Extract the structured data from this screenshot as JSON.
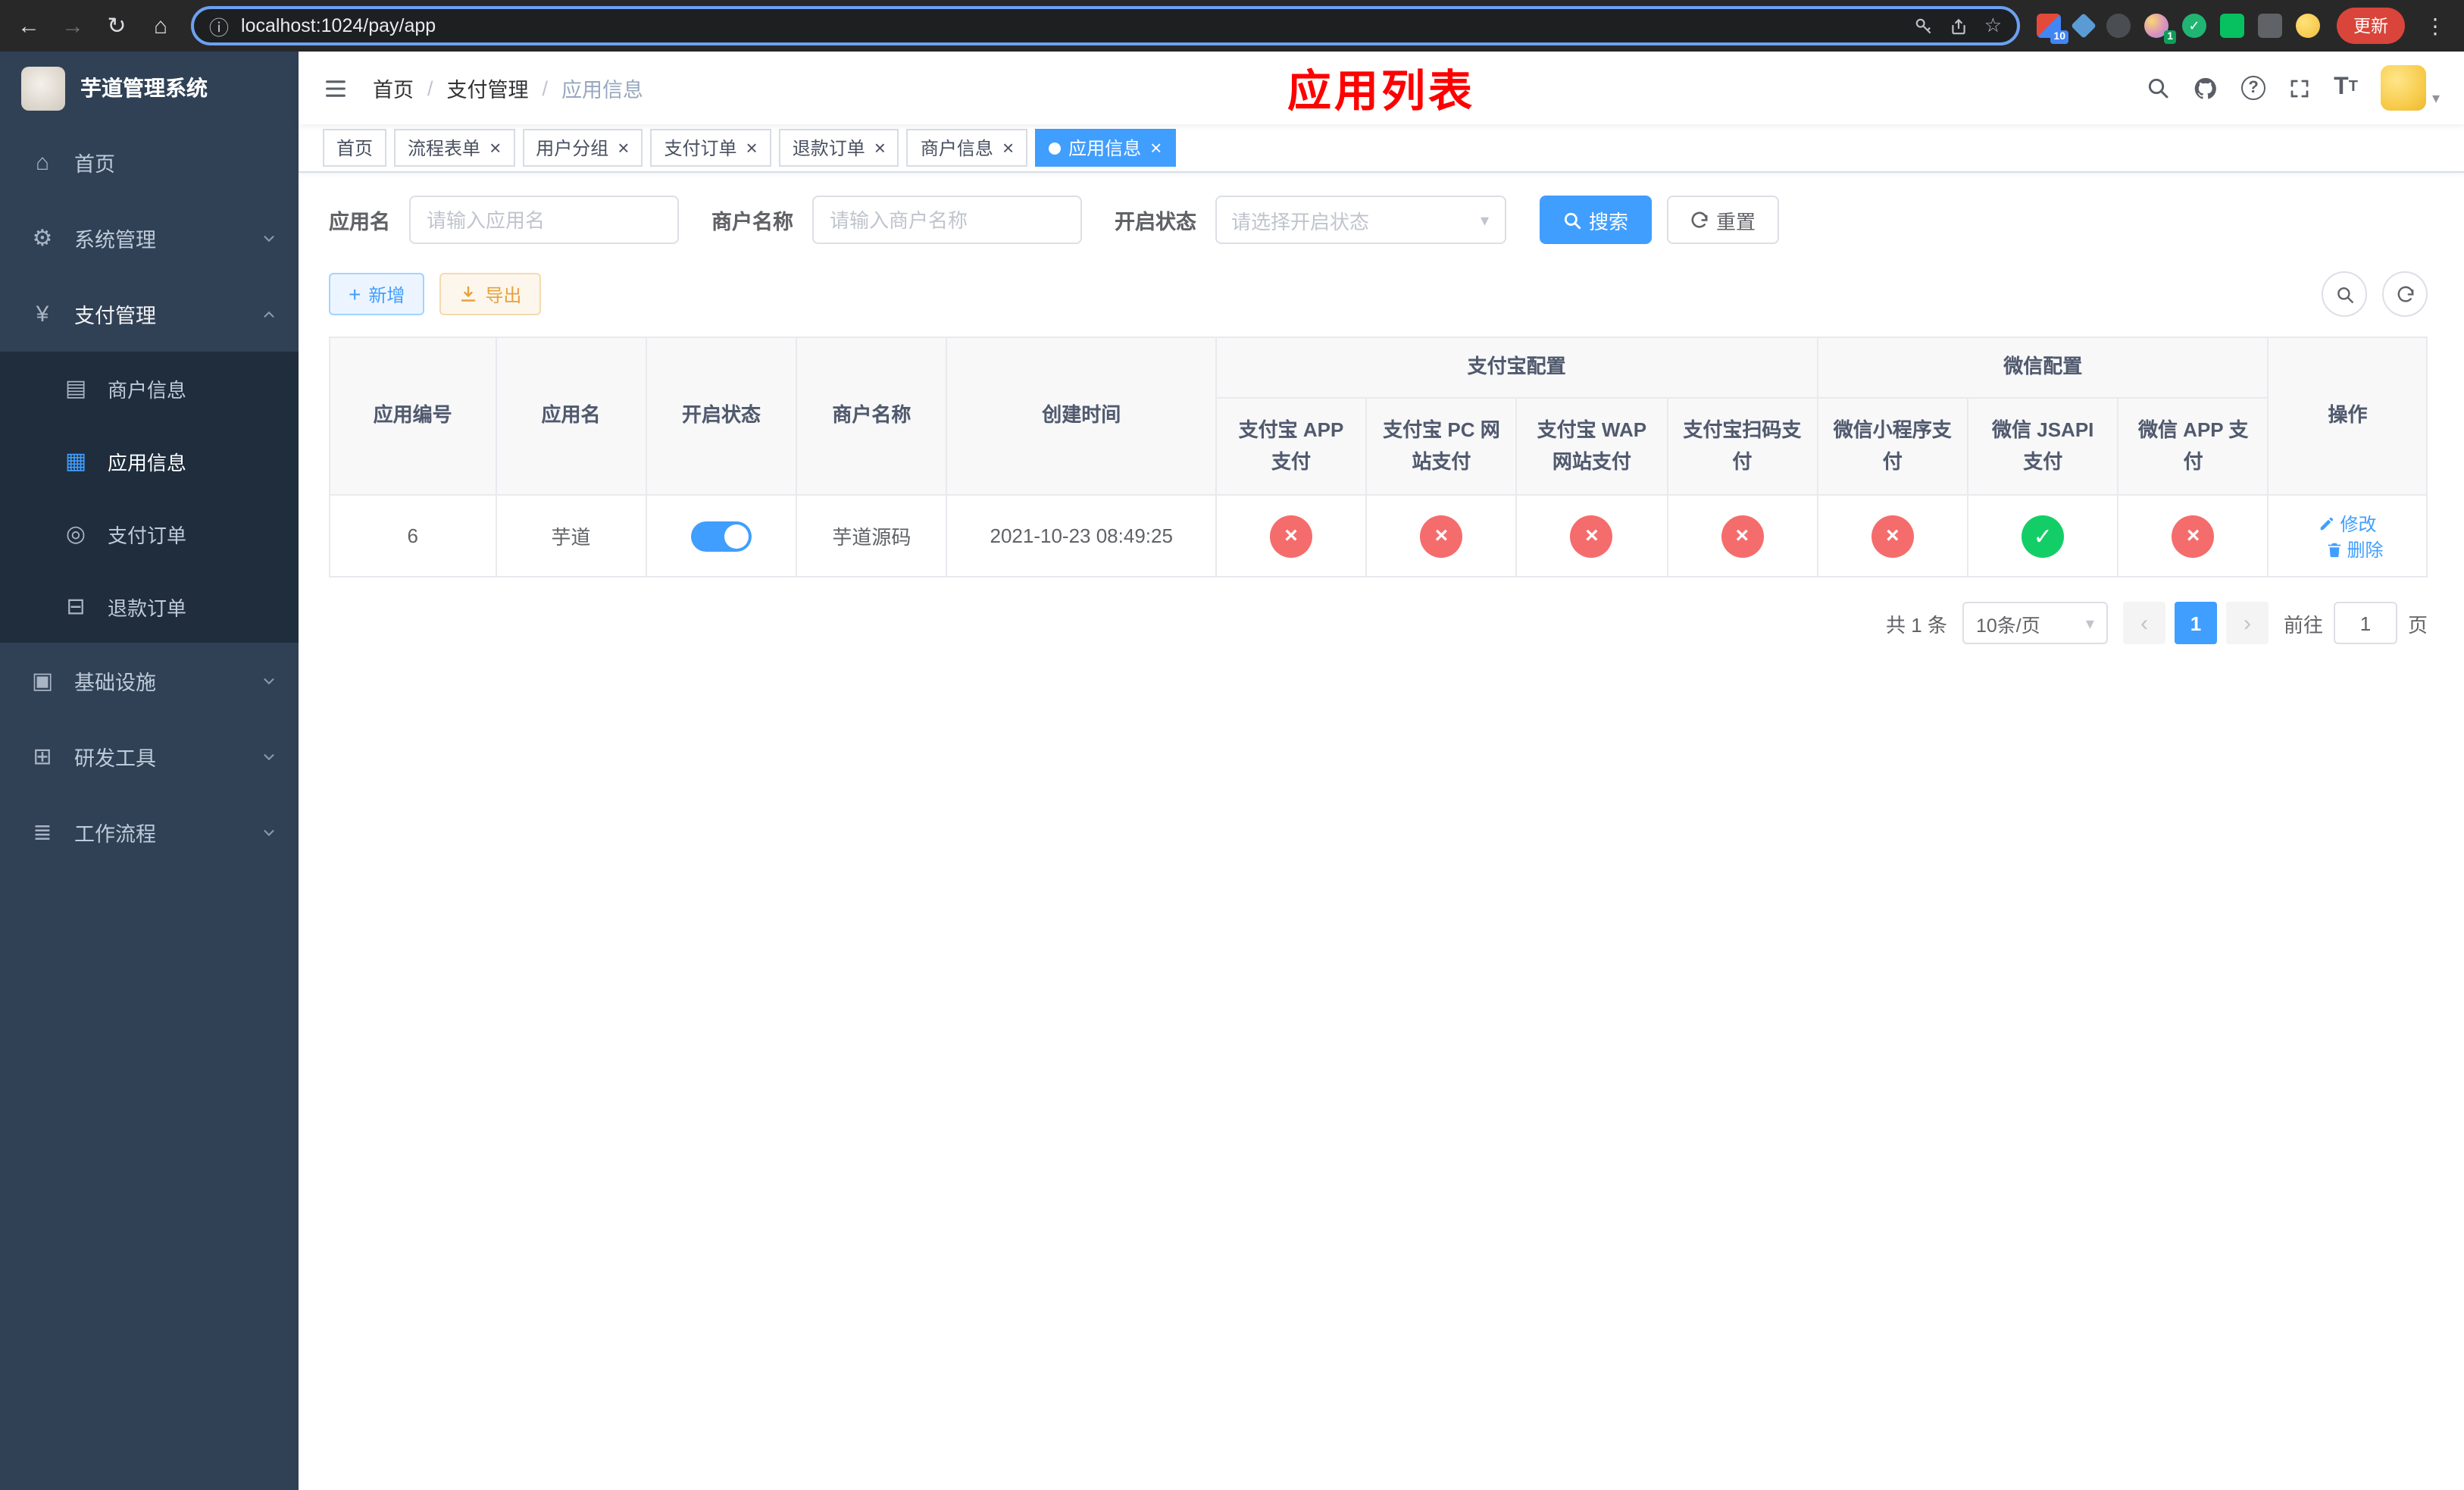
{
  "browser": {
    "url": "localhost:1024/pay/app",
    "update_label": "更新",
    "extension_badge": "10",
    "avatar_badge": "1"
  },
  "sidebar": {
    "logo_title": "芋道管理系统",
    "items": [
      {
        "label": "首页"
      },
      {
        "label": "系统管理"
      },
      {
        "label": "支付管理",
        "children": [
          {
            "label": "商户信息"
          },
          {
            "label": "应用信息"
          },
          {
            "label": "支付订单"
          },
          {
            "label": "退款订单"
          }
        ]
      },
      {
        "label": "基础设施"
      },
      {
        "label": "研发工具"
      },
      {
        "label": "工作流程"
      }
    ]
  },
  "header": {
    "breadcrumb": [
      "首页",
      "支付管理",
      "应用信息"
    ],
    "page_title": "应用列表"
  },
  "tabs": [
    {
      "label": "首页"
    },
    {
      "label": "流程表单"
    },
    {
      "label": "用户分组"
    },
    {
      "label": "支付订单"
    },
    {
      "label": "退款订单"
    },
    {
      "label": "商户信息"
    },
    {
      "label": "应用信息"
    }
  ],
  "filters": {
    "app_name_label": "应用名",
    "app_name_placeholder": "请输入应用名",
    "merchant_label": "商户名称",
    "merchant_placeholder": "请输入商户名称",
    "status_label": "开启状态",
    "status_placeholder": "请选择开启状态",
    "search_label": "搜索",
    "reset_label": "重置"
  },
  "toolbar": {
    "add_label": "新增",
    "export_label": "导出"
  },
  "table": {
    "groups": {
      "alipay": "支付宝配置",
      "wechat": "微信配置"
    },
    "columns": [
      "应用编号",
      "应用名",
      "开启状态",
      "商户名称",
      "创建时间",
      "支付宝 APP 支付",
      "支付宝 PC 网站支付",
      "支付宝 WAP 网站支付",
      "支付宝扫码支付",
      "微信小程序支付",
      "微信 JSAPI 支付",
      "微信 APP 支付",
      "操作"
    ],
    "rows": [
      {
        "id": "6",
        "app_name": "芋道",
        "status_on": true,
        "merchant_name": "芋道源码",
        "created_at": "2021-10-23 08:49:25",
        "configs": [
          "no",
          "no",
          "no",
          "no",
          "no",
          "yes",
          "no"
        ],
        "edit_label": "修改",
        "delete_label": "删除"
      }
    ]
  },
  "pagination": {
    "total_text": "共 1 条",
    "page_size": "10条/页",
    "current_page": "1",
    "goto_label": "前往",
    "goto_value": "1",
    "unit_label": "页"
  },
  "colors": {
    "accent": "#409eff",
    "danger": "#f56c6c",
    "success": "#13ce66",
    "warning": "#e6a23c",
    "title_red": "#ff0000",
    "sidebar_bg": "#304156",
    "sidebar_submenu_bg": "#1f2d3d"
  }
}
